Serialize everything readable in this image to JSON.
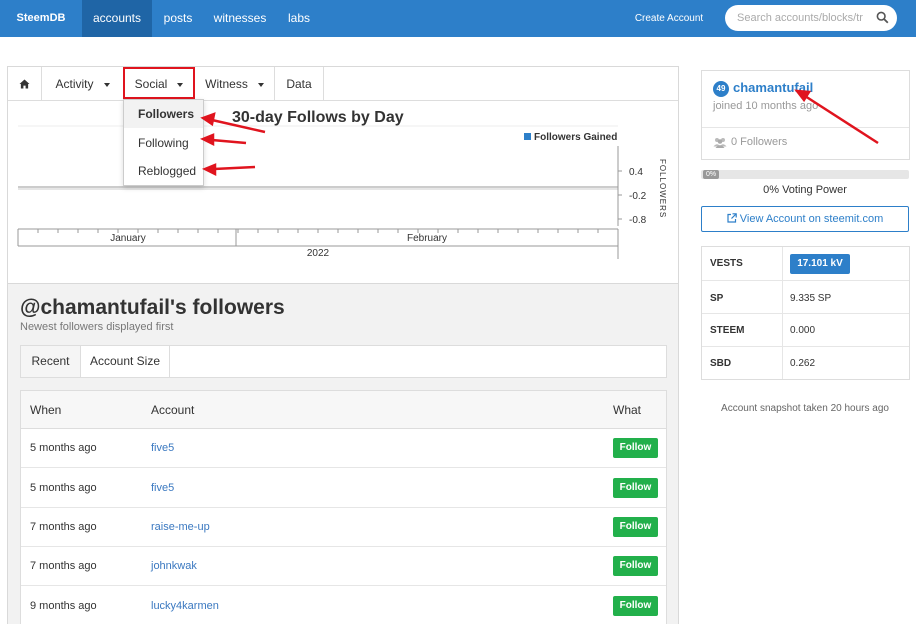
{
  "navbar": {
    "brand": "SteemDB",
    "items": [
      {
        "label": "accounts",
        "active": true
      },
      {
        "label": "posts"
      },
      {
        "label": "witnesses"
      },
      {
        "label": "labs"
      }
    ],
    "create_account": "Create Account",
    "search_placeholder": "Search accounts/blocks/tr",
    "search_icon": "search-icon"
  },
  "tabs": {
    "home_icon": "home-icon",
    "activity": "Activity",
    "social": "Social",
    "witness": "Witness",
    "data": "Data"
  },
  "social_menu": {
    "items": [
      "Followers",
      "Following",
      "Reblogged"
    ]
  },
  "chart_data": {
    "type": "bar",
    "title": "30-day Follows by Day",
    "series": [
      {
        "name": "Followers Gained",
        "values": []
      }
    ],
    "ylabel": "FOLLOWERS",
    "yticks": [
      "0.4",
      "-0.2",
      "-0.8"
    ],
    "xticks": [
      "January",
      "February"
    ],
    "xlabel": "2022",
    "colors": {
      "followers_gained": "#2d7fc9"
    }
  },
  "followers": {
    "title": "@chamantufail's followers",
    "subtitle": "Newest followers displayed first",
    "tabs": [
      "Recent",
      "Account Size"
    ],
    "columns": {
      "when": "When",
      "account": "Account",
      "what": "What"
    },
    "rows": [
      {
        "when": "5 months ago",
        "account": "five5",
        "action": "Follow"
      },
      {
        "when": "5 months ago",
        "account": "five5",
        "action": "Follow"
      },
      {
        "when": "7 months ago",
        "account": "raise-me-up",
        "action": "Follow"
      },
      {
        "when": "7 months ago",
        "account": "johnkwak",
        "action": "Follow"
      },
      {
        "when": "9 months ago",
        "account": "lucky4karmen",
        "action": "Follow"
      }
    ]
  },
  "profile": {
    "reputation": "49",
    "username": "chamantufail",
    "joined": "joined 10 months ago",
    "followers": "0 Followers",
    "voting_power_badge": "0%",
    "voting_power_value": 0,
    "voting_power_text": "0% Voting Power",
    "view_button": "View Account on steemit.com"
  },
  "stats": [
    {
      "key": "VESTS",
      "value": "17.101 kV"
    },
    {
      "key": "SP",
      "value": "9.335 SP"
    },
    {
      "key": "STEEM",
      "value": "0.000"
    },
    {
      "key": "SBD",
      "value": "0.262"
    }
  ],
  "snapshot": "Account snapshot taken 20 hours ago",
  "colors": {
    "primary": "#2d7fc9",
    "follow": "#22b04b",
    "highlight": "#e0141e"
  }
}
